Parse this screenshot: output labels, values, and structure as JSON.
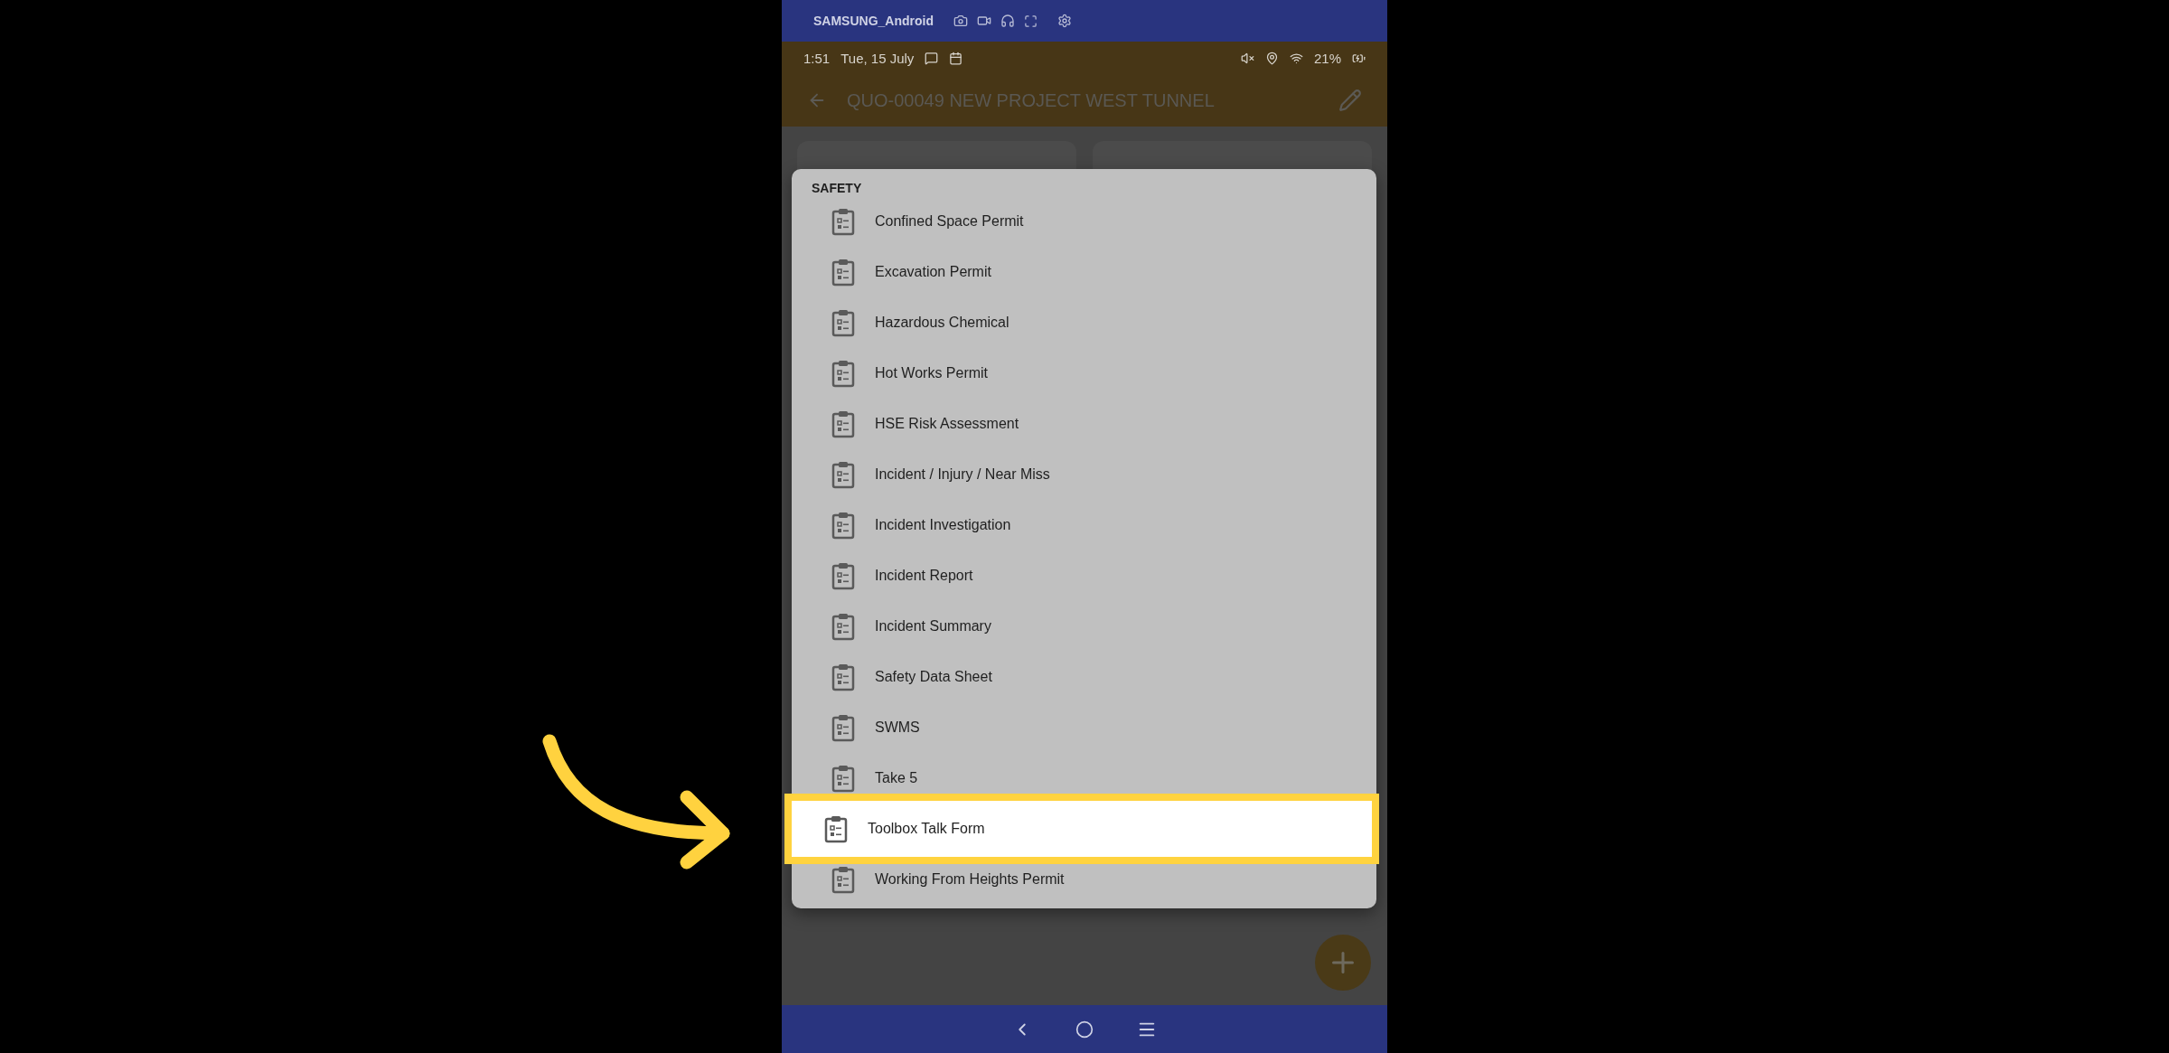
{
  "host_bar": {
    "title": "SAMSUNG_Android"
  },
  "status_bar": {
    "time": "1:51",
    "date": "Tue, 15 July",
    "battery": "21%"
  },
  "app_bar": {
    "title": "QUO-00049 NEW PROJECT WEST TUNNEL"
  },
  "dialog": {
    "section": "SAFETY",
    "items": [
      {
        "label": "Confined Space Permit",
        "selected": false
      },
      {
        "label": "Excavation Permit",
        "selected": false
      },
      {
        "label": "Hazardous Chemical",
        "selected": false
      },
      {
        "label": "Hot Works Permit",
        "selected": false
      },
      {
        "label": "HSE Risk Assessment",
        "selected": false
      },
      {
        "label": "Incident / Injury / Near Miss",
        "selected": false
      },
      {
        "label": "Incident Investigation",
        "selected": false
      },
      {
        "label": "Incident Report",
        "selected": false
      },
      {
        "label": "Incident Summary",
        "selected": false
      },
      {
        "label": "Safety Data Sheet",
        "selected": false
      },
      {
        "label": "SWMS",
        "selected": false
      },
      {
        "label": "Take 5",
        "selected": false
      },
      {
        "label": "Toolbox Talk Form",
        "selected": true
      },
      {
        "label": "Working From Heights Permit",
        "selected": false
      }
    ]
  }
}
